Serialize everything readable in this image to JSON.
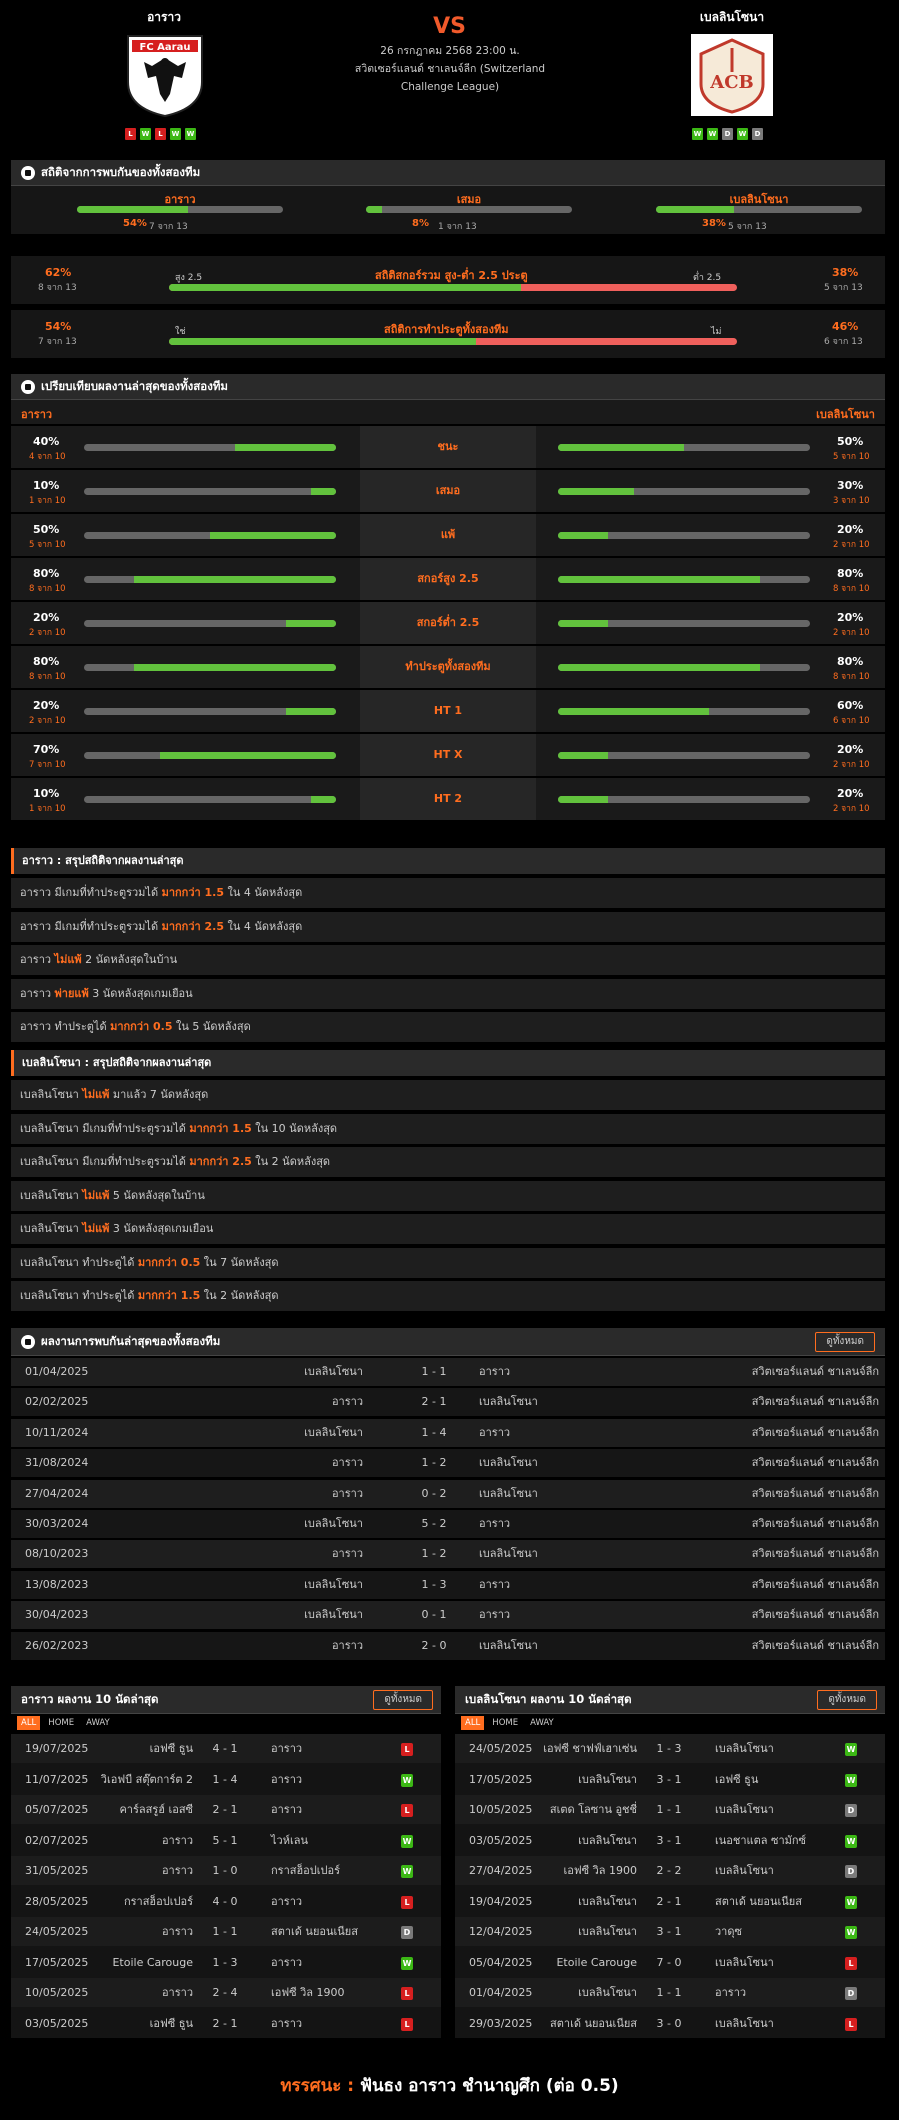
{
  "header": {
    "home": "อาราว",
    "away": "เบลลินโซนา",
    "vs": "VS",
    "date": "26 กรกฎาคม 2568 23:00 น.",
    "league": "สวิตเซอร์แลนด์ ชาเลนจ์ลีก (Switzerland Challenge League)",
    "home_form": [
      "L",
      "W",
      "L",
      "W",
      "W"
    ],
    "away_form": [
      "W",
      "W",
      "D",
      "W",
      "D"
    ],
    "home_logo_text": "FC Aarau",
    "away_logo_text": "ACB"
  },
  "h2h_stats": {
    "title": "สถิติจากการพบกันของทั้งสองทีม",
    "cols": [
      {
        "label": "อาราว",
        "pct": "54%",
        "sub": "7 จาก 13",
        "fill": 0.54
      },
      {
        "label": "เสมอ",
        "pct": "8%",
        "sub": "1 จาก 13",
        "fill": 0.08
      },
      {
        "label": "เบลลินโซนา",
        "pct": "38%",
        "sub": "5 จาก 13",
        "fill": 0.38
      }
    ],
    "ou": {
      "title": "สถิติสกอร์รวม สูง-ต่ำ 2.5 ประตู",
      "left_label": "สูง 2.5",
      "right_label": "ต่ำ 2.5",
      "left_pct": "62%",
      "left_sub": "8 จาก 13",
      "right_pct": "38%",
      "right_sub": "5 จาก 13",
      "fill": 0.62
    },
    "btts": {
      "title": "สถิติการทำประตูทั้งสองทีม",
      "left_label": "ใช่",
      "right_label": "ไม่",
      "left_pct": "54%",
      "left_sub": "7 จาก 13",
      "right_pct": "46%",
      "right_sub": "6 จาก 13",
      "fill": 0.54
    }
  },
  "compare": {
    "title": "เปรียบเทียบผลงานล่าสุดของทั้งสองทีม",
    "home": "อาราว",
    "away": "เบลลินโซนา",
    "rows": [
      {
        "label": "ชนะ",
        "hp": "40%",
        "hs": "4 จาก 10",
        "hf": 0.4,
        "ap": "50%",
        "as": "5 จาก 10",
        "af": 0.5
      },
      {
        "label": "เสมอ",
        "hp": "10%",
        "hs": "1 จาก 10",
        "hf": 0.1,
        "ap": "30%",
        "as": "3 จาก 10",
        "af": 0.3
      },
      {
        "label": "แพ้",
        "hp": "50%",
        "hs": "5 จาก 10",
        "hf": 0.5,
        "ap": "20%",
        "as": "2 จาก 10",
        "af": 0.2
      },
      {
        "label": "สกอร์สูง 2.5",
        "hp": "80%",
        "hs": "8 จาก 10",
        "hf": 0.8,
        "ap": "80%",
        "as": "8 จาก 10",
        "af": 0.8
      },
      {
        "label": "สกอร์ต่ำ 2.5",
        "hp": "20%",
        "hs": "2 จาก 10",
        "hf": 0.2,
        "ap": "20%",
        "as": "2 จาก 10",
        "af": 0.2
      },
      {
        "label": "ทำประตูทั้งสองทีม",
        "hp": "80%",
        "hs": "8 จาก 10",
        "hf": 0.8,
        "ap": "80%",
        "as": "8 จาก 10",
        "af": 0.8
      },
      {
        "label": "HT 1",
        "hp": "20%",
        "hs": "2 จาก 10",
        "hf": 0.2,
        "ap": "60%",
        "as": "6 จาก 10",
        "af": 0.6
      },
      {
        "label": "HT X",
        "hp": "70%",
        "hs": "7 จาก 10",
        "hf": 0.7,
        "ap": "20%",
        "as": "2 จาก 10",
        "af": 0.2
      },
      {
        "label": "HT 2",
        "hp": "10%",
        "hs": "1 จาก 10",
        "hf": 0.1,
        "ap": "20%",
        "as": "2 จาก 10",
        "af": 0.2
      }
    ]
  },
  "home_summary": {
    "title": "อาราว : สรุปสถิติจากผลงานล่าสุด",
    "lines": [
      [
        "อาราว มีเกมที่ทำประตูรวมได้ ",
        "มากกว่า 1.5",
        " ใน 4 นัดหลังสุด"
      ],
      [
        "อาราว มีเกมที่ทำประตูรวมได้ ",
        "มากกว่า 2.5",
        " ใน 4 นัดหลังสุด"
      ],
      [
        "อาราว ",
        "ไม่แพ้",
        " 2 นัดหลังสุดในบ้าน"
      ],
      [
        "อาราว ",
        "พ่ายแพ้",
        " 3 นัดหลังสุดเกมเยือน"
      ],
      [
        "อาราว ทำประตูได้ ",
        "มากกว่า 0.5",
        " ใน 5 นัดหลังสุด"
      ]
    ]
  },
  "away_summary": {
    "title": "เบลลินโซนา : สรุปสถิติจากผลงานล่าสุด",
    "lines": [
      [
        "เบลลินโซนา ",
        "ไม่แพ้",
        " มาแล้ว 7 นัดหลังสุด"
      ],
      [
        "เบลลินโซนา มีเกมที่ทำประตูรวมได้ ",
        "มากกว่า 1.5",
        " ใน 10 นัดหลังสุด"
      ],
      [
        "เบลลินโซนา มีเกมที่ทำประตูรวมได้ ",
        "มากกว่า 2.5",
        " ใน 2 นัดหลังสุด"
      ],
      [
        "เบลลินโซนา ",
        "ไม่แพ้",
        " 5 นัดหลังสุดในบ้าน"
      ],
      [
        "เบลลินโซนา ",
        "ไม่แพ้",
        " 3 นัดหลังสุดเกมเยือน"
      ],
      [
        "เบลลินโซนา ทำประตูได้ ",
        "มากกว่า 0.5",
        " ใน 7 นัดหลังสุด"
      ],
      [
        "เบลลินโซนา ทำประตูได้ ",
        "มากกว่า 1.5",
        " ใน 2 นัดหลังสุด"
      ]
    ]
  },
  "h2h_results": {
    "title": "ผลงานการพบกันล่าสุดของทั้งสองทีม",
    "view_all": "ดูทั้งหมด",
    "rows": [
      [
        "01/04/2025",
        "เบลลินโซนา",
        "1 - 1",
        "อาราว",
        "สวิตเซอร์แลนด์ ชาเลนจ์ลีก"
      ],
      [
        "02/02/2025",
        "อาราว",
        "2 - 1",
        "เบลลินโซนา",
        "สวิตเซอร์แลนด์ ชาเลนจ์ลีก"
      ],
      [
        "10/11/2024",
        "เบลลินโซนา",
        "1 - 4",
        "อาราว",
        "สวิตเซอร์แลนด์ ชาเลนจ์ลีก"
      ],
      [
        "31/08/2024",
        "อาราว",
        "1 - 2",
        "เบลลินโซนา",
        "สวิตเซอร์แลนด์ ชาเลนจ์ลีก"
      ],
      [
        "27/04/2024",
        "อาราว",
        "0 - 2",
        "เบลลินโซนา",
        "สวิตเซอร์แลนด์ ชาเลนจ์ลีก"
      ],
      [
        "30/03/2024",
        "เบลลินโซนา",
        "5 - 2",
        "อาราว",
        "สวิตเซอร์แลนด์ ชาเลนจ์ลีก"
      ],
      [
        "08/10/2023",
        "อาราว",
        "1 - 2",
        "เบลลินโซนา",
        "สวิตเซอร์แลนด์ ชาเลนจ์ลีก"
      ],
      [
        "13/08/2023",
        "เบลลินโซนา",
        "1 - 3",
        "อาราว",
        "สวิตเซอร์แลนด์ ชาเลนจ์ลีก"
      ],
      [
        "30/04/2023",
        "เบลลินโซนา",
        "0 - 1",
        "อาราว",
        "สวิตเซอร์แลนด์ ชาเลนจ์ลีก"
      ],
      [
        "26/02/2023",
        "อาราว",
        "2 - 0",
        "เบลลินโซนา",
        "สวิตเซอร์แลนด์ ชาเลนจ์ลีก"
      ]
    ]
  },
  "home_last10": {
    "title": "อาราว ผลงาน 10 นัดล่าสุด",
    "view_all": "ดูทั้งหมด",
    "tabs": [
      "ALL",
      "HOME",
      "AWAY"
    ],
    "rows": [
      [
        "19/07/2025",
        "เอฟซี ธูน",
        "4 - 1",
        "อาราว",
        "L"
      ],
      [
        "11/07/2025",
        "วิเอฟบี สตุ๊ตการ์ต 2",
        "1 - 4",
        "อาราว",
        "W"
      ],
      [
        "05/07/2025",
        "คาร์ลสรูฮ์ เอสซี",
        "2 - 1",
        "อาราว",
        "L"
      ],
      [
        "02/07/2025",
        "อาราว",
        "5 - 1",
        "ไวห์เลน",
        "W"
      ],
      [
        "31/05/2025",
        "อาราว",
        "1 - 0",
        "กราสฮ็อปเปอร์",
        "W"
      ],
      [
        "28/05/2025",
        "กราสฮ็อปเปอร์",
        "4 - 0",
        "อาราว",
        "L"
      ],
      [
        "24/05/2025",
        "อาราว",
        "1 - 1",
        "สตาเด้ นยอนเนียส",
        "D"
      ],
      [
        "17/05/2025",
        "Etoile Carouge",
        "1 - 3",
        "อาราว",
        "W"
      ],
      [
        "10/05/2025",
        "อาราว",
        "2 - 4",
        "เอฟซี วิล 1900",
        "L"
      ],
      [
        "03/05/2025",
        "เอฟซี ธูน",
        "2 - 1",
        "อาราว",
        "L"
      ]
    ]
  },
  "away_last10": {
    "title": "เบลลินโซนา ผลงาน 10 นัดล่าสุด",
    "view_all": "ดูทั้งหมด",
    "tabs": [
      "ALL",
      "HOME",
      "AWAY"
    ],
    "rows": [
      [
        "24/05/2025",
        "เอฟซี ชาฟฟ์เฮาเซ่น",
        "1 - 3",
        "เบลลินโซนา",
        "W"
      ],
      [
        "17/05/2025",
        "เบลลินโซนา",
        "3 - 1",
        "เอฟซี ธูน",
        "W"
      ],
      [
        "10/05/2025",
        "สเตด โลซาน อูชชี่",
        "1 - 1",
        "เบลลินโซนา",
        "D"
      ],
      [
        "03/05/2025",
        "เบลลินโซนา",
        "3 - 1",
        "เนอชาแตล ซามักซ์",
        "W"
      ],
      [
        "27/04/2025",
        "เอฟซี วิล 1900",
        "2 - 2",
        "เบลลินโซนา",
        "D"
      ],
      [
        "19/04/2025",
        "เบลลินโซนา",
        "2 - 1",
        "สตาเด้ นยอนเนียส",
        "W"
      ],
      [
        "12/04/2025",
        "เบลลินโซนา",
        "3 - 1",
        "วาดุซ",
        "W"
      ],
      [
        "05/04/2025",
        "Etoile Carouge",
        "7 - 0",
        "เบลลินโซนา",
        "L"
      ],
      [
        "01/04/2025",
        "เบลลินโซนา",
        "1 - 1",
        "อาราว",
        "D"
      ],
      [
        "29/03/2025",
        "สตาเด้ นยอนเนียส",
        "3 - 0",
        "เบลลินโซนา",
        "L"
      ]
    ]
  },
  "footer": {
    "label": "ทรรศนะ :",
    "text": " ฟันธง อาราว ชำนาญศึก (ต่อ 0.5)"
  }
}
